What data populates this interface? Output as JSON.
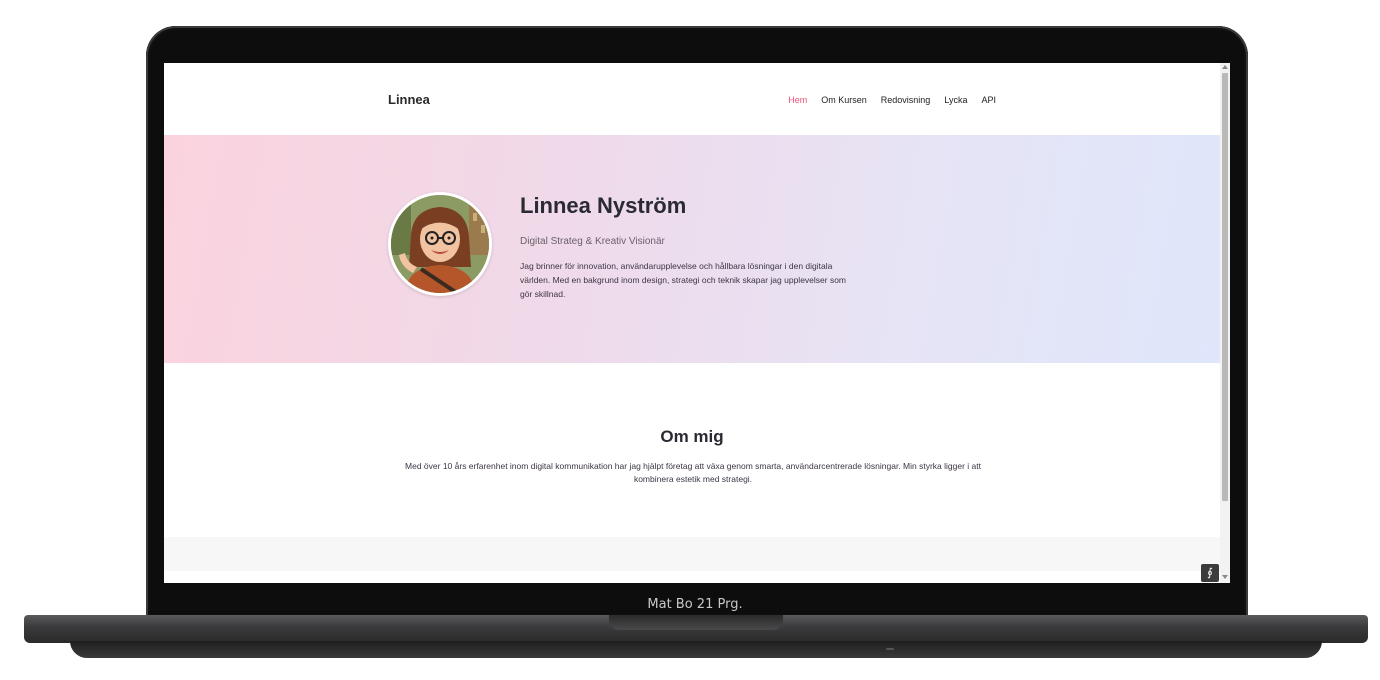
{
  "device": {
    "bezel_label": "Mat Bo 21 Prg."
  },
  "nav": {
    "brand": "Linnea",
    "items": [
      "Hem",
      "Om Kursen",
      "Redovisning",
      "Lycka",
      "API"
    ],
    "active_color": "#e8537a"
  },
  "hero": {
    "name": "Linnea Nyström",
    "subtitle": "Digital Strateg & Kreativ Visionär",
    "text": "Jag brinner för innovation, användarupplevelse och hållbara lösningar i den digitala världen. Med en bakgrund inom design, strategi och teknik skapar jag upplevelser som gör skillnad.",
    "gradient": [
      "#fbd3de",
      "#dfe6fb"
    ],
    "avatar_icon": "avatar-illustration"
  },
  "about": {
    "title": "Om mig",
    "text": "Med över 10 års erfarenhet inom digital kommunikation har jag hjälpt företag att växa genom smarta, användarcentrerade lösningar. Min styrka ligger i att kombinera estetik med strategi."
  },
  "corner_badge": {
    "icon": "extension-icon",
    "glyph": "∮"
  }
}
